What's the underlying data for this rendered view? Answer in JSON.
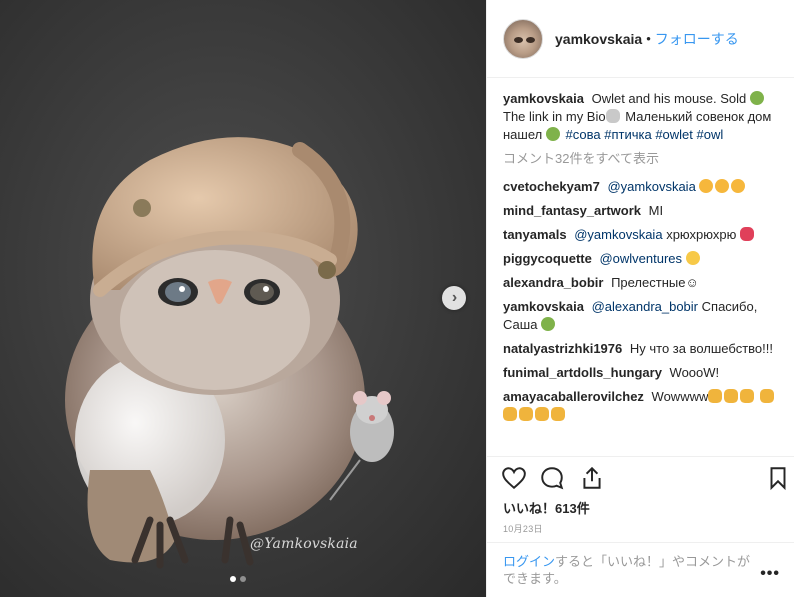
{
  "post": {
    "username": "yamkovskaia",
    "separator": "•",
    "follow_label": "フォローする",
    "image": {
      "watermark": "@Yamkovskaia",
      "carousel_pages": 2,
      "carousel_current": 1
    },
    "caption": {
      "user": "yamkovskaia",
      "text_1": "Owlet and his mouse. Sold",
      "text_2": "The link in my Bio",
      "text_3": "Маленький совенок дом нашел",
      "tags": [
        "#сова",
        "#птичка",
        "#owlet",
        "#owl"
      ]
    },
    "view_all_comments": "コメント32件をすべて表示",
    "comments": [
      {
        "user": "cvetochekyam7",
        "mention": "@yamkovskaia",
        "text": ""
      },
      {
        "user": "mind_fantasy_artwork",
        "mention": "",
        "text": "MI"
      },
      {
        "user": "tanyamals",
        "mention": "@yamkovskaia",
        "text": "хрюхрюхрю"
      },
      {
        "user": "piggycoquette",
        "mention": "@owlventures",
        "text": ""
      },
      {
        "user": "alexandra_bobir",
        "mention": "",
        "text": "Прелестные☺"
      },
      {
        "user": "yamkovskaia",
        "mention": "@alexandra_bobir",
        "text": "Спасибо, Саша"
      },
      {
        "user": "natalyastrizhki1976",
        "mention": "",
        "text": "Ну что за волшебство!!!"
      },
      {
        "user": "funimal_artdolls_hungary",
        "mention": "",
        "text": "WoooW!"
      },
      {
        "user": "amayacaballerovilchez",
        "mention": "",
        "text": "Wowwww"
      }
    ],
    "likes_label": "いいね！613件",
    "date": "10月23日",
    "footer": {
      "login": "ログイン",
      "text": "すると「いいね！」やコメントができます。",
      "more": "•••"
    }
  }
}
